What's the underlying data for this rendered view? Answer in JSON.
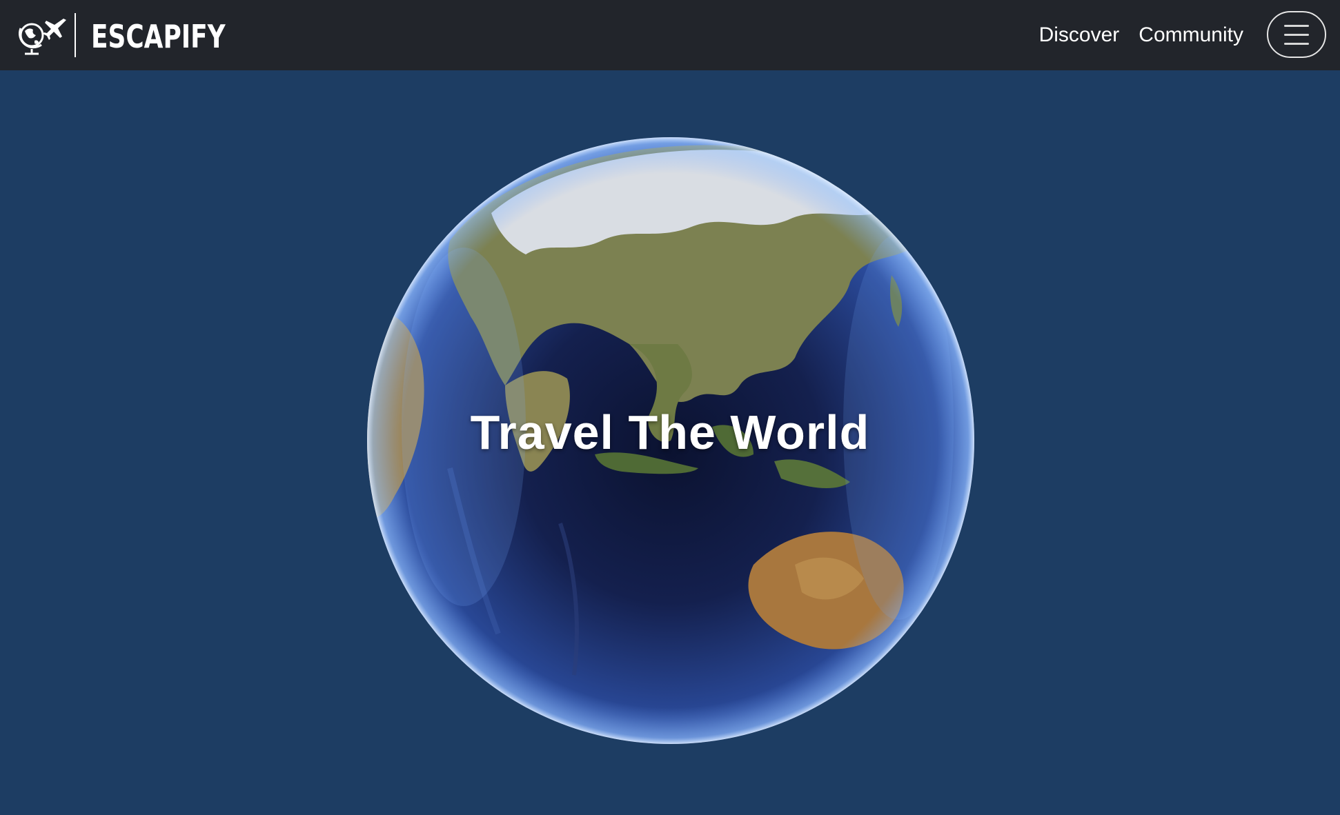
{
  "header": {
    "brand_name": "ESCAPIFY",
    "logo_icon": "globe-airplane-icon",
    "nav": [
      {
        "label": "Discover"
      },
      {
        "label": "Community"
      }
    ],
    "menu_icon": "hamburger-menu-icon"
  },
  "hero": {
    "title": "Travel The World",
    "image": "earth-globe"
  },
  "colors": {
    "navbar_bg": "#22252b",
    "page_bg": "#1d3d63",
    "text": "#ffffff"
  }
}
